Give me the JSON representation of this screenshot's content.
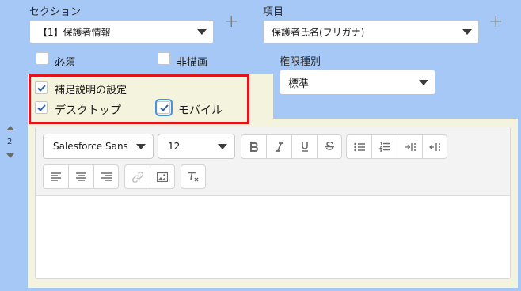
{
  "section": {
    "label": "セクション",
    "selected": "【1】保護者情報"
  },
  "item": {
    "label": "項目",
    "selected": "保護者氏名(フリガナ)"
  },
  "checkboxes": {
    "required": "必須",
    "no_render": "非描画",
    "help_setting": "補足説明の設定",
    "desktop": "デスクトップ",
    "mobile": "モバイル"
  },
  "permission": {
    "label": "権限種別",
    "selected": "標準"
  },
  "order": {
    "value": "2"
  },
  "editor": {
    "font_family": "Salesforce Sans",
    "font_size": "12"
  },
  "colors": {
    "background": "#a6c8f7",
    "panel": "#f4f3dd",
    "highlight_border": "#e0151b",
    "check": "#2b62b3"
  },
  "icons": [
    "plus-icon",
    "caret-down-icon",
    "check-icon",
    "sort-up-icon",
    "sort-down-icon",
    "bold-icon",
    "italic-icon",
    "underline-icon",
    "strikethrough-icon",
    "bullet-list-icon",
    "numbered-list-icon",
    "indent-icon",
    "outdent-icon",
    "align-left-icon",
    "align-center-icon",
    "align-right-icon",
    "link-icon",
    "image-icon",
    "clear-format-icon"
  ]
}
